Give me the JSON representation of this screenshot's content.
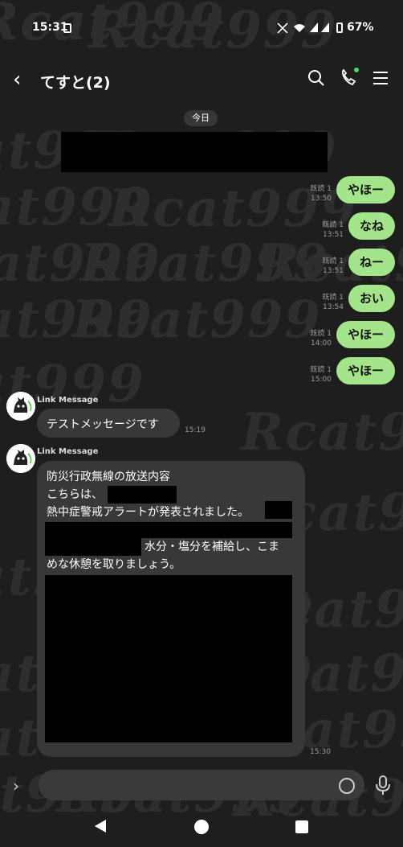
{
  "status_bar": {
    "time": "15:31",
    "battery": "67%"
  },
  "header": {
    "title": "てすと(2)"
  },
  "date_label": "今日",
  "watermark": "Rcat999",
  "sent_messages": [
    {
      "read": "既読 1",
      "time": "13:50",
      "text": "やほー"
    },
    {
      "read": "既読 1",
      "time": "13:51",
      "text": "なね"
    },
    {
      "read": "既読 1",
      "time": "13:51",
      "text": "ねー"
    },
    {
      "read": "既読 1",
      "time": "13:54",
      "text": "おい"
    },
    {
      "read": "既読 1",
      "time": "14:00",
      "text": "やほー"
    },
    {
      "read": "既読 1",
      "time": "15:00",
      "text": "やほー"
    }
  ],
  "received_messages": [
    {
      "sender": "Link Message",
      "text": "テストメッセージです",
      "time": "15:19"
    },
    {
      "sender": "Link Message",
      "line1": "防災行政無線の放送内容",
      "line2": "こちらは、",
      "line3": "熱中症警戒アラートが発表されました。",
      "line4": "水分・塩分を補給し、こま",
      "line5": "めな休憩を取りましょう。",
      "time": "15:30"
    }
  ],
  "colors": {
    "sent_bubble": "#a4e48a",
    "received_bubble": "#383838",
    "background": "#1e1e1e",
    "online_dot": "#4cd964"
  }
}
